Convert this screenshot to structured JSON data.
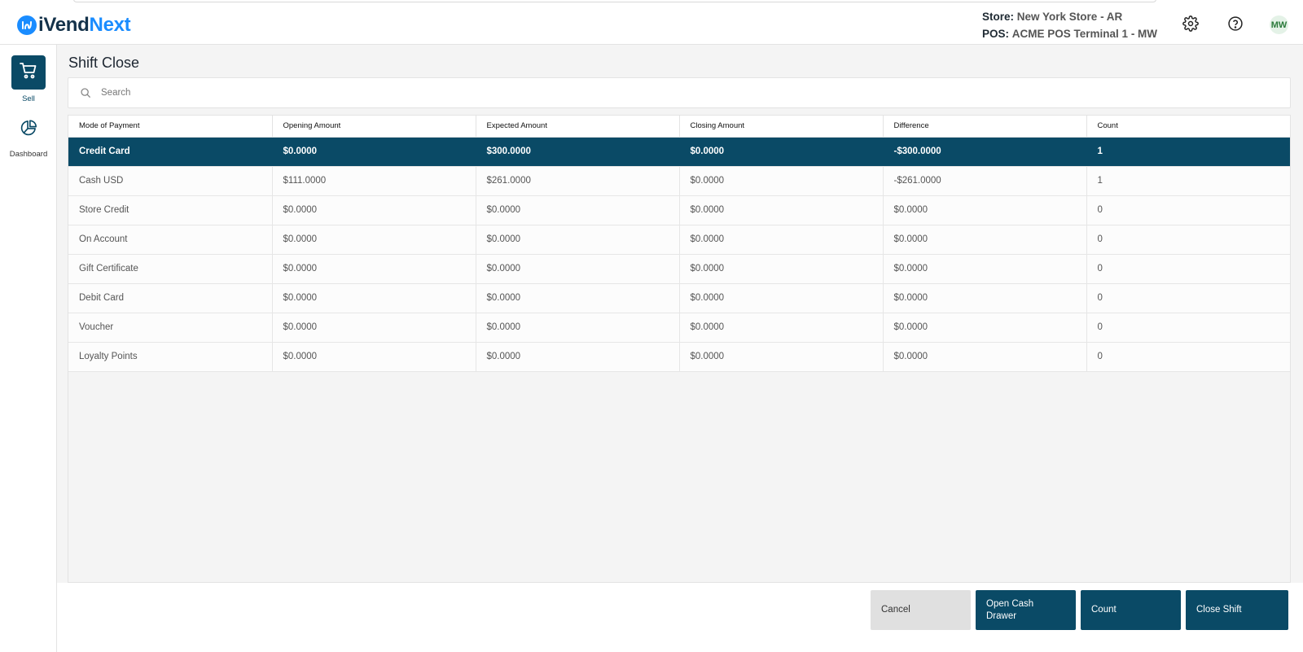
{
  "app": {
    "name_part1": "iVend",
    "name_part2": "Next"
  },
  "header": {
    "store_label": "Store:",
    "store_value": "New York Store - AR",
    "pos_label": "POS:",
    "pos_value": "ACME POS Terminal 1 - MW",
    "user_initials": "MW"
  },
  "nav": {
    "items": [
      {
        "label": "Sell",
        "icon": "cart-icon",
        "active": true
      },
      {
        "label": "Dashboard",
        "icon": "pie-chart-icon",
        "active": false
      }
    ]
  },
  "page": {
    "title": "Shift Close",
    "search_placeholder": "Search"
  },
  "table": {
    "columns": [
      "Mode of Payment",
      "Opening Amount",
      "Expected Amount",
      "Closing Amount",
      "Difference",
      "Count"
    ],
    "rows": [
      [
        "Credit Card",
        "$0.0000",
        "$300.0000",
        "$0.0000",
        "-$300.0000",
        "1"
      ],
      [
        "Cash USD",
        "$111.0000",
        "$261.0000",
        "$0.0000",
        "-$261.0000",
        "1"
      ],
      [
        "Store Credit",
        "$0.0000",
        "$0.0000",
        "$0.0000",
        "$0.0000",
        "0"
      ],
      [
        "On Account",
        "$0.0000",
        "$0.0000",
        "$0.0000",
        "$0.0000",
        "0"
      ],
      [
        "Gift Certificate",
        "$0.0000",
        "$0.0000",
        "$0.0000",
        "$0.0000",
        "0"
      ],
      [
        "Debit Card",
        "$0.0000",
        "$0.0000",
        "$0.0000",
        "$0.0000",
        "0"
      ],
      [
        "Voucher",
        "$0.0000",
        "$0.0000",
        "$0.0000",
        "$0.0000",
        "0"
      ],
      [
        "Loyalty Points",
        "$0.0000",
        "$0.0000",
        "$0.0000",
        "$0.0000",
        "0"
      ]
    ],
    "selected_row": 0
  },
  "footer": {
    "cancel": "Cancel",
    "open_cash_drawer": "Open Cash Drawer",
    "count": "Count",
    "close_shift": "Close Shift"
  },
  "colors": {
    "primary": "#0a4a66",
    "brand_blue": "#1a8cff",
    "background": "#f4f4f4"
  }
}
